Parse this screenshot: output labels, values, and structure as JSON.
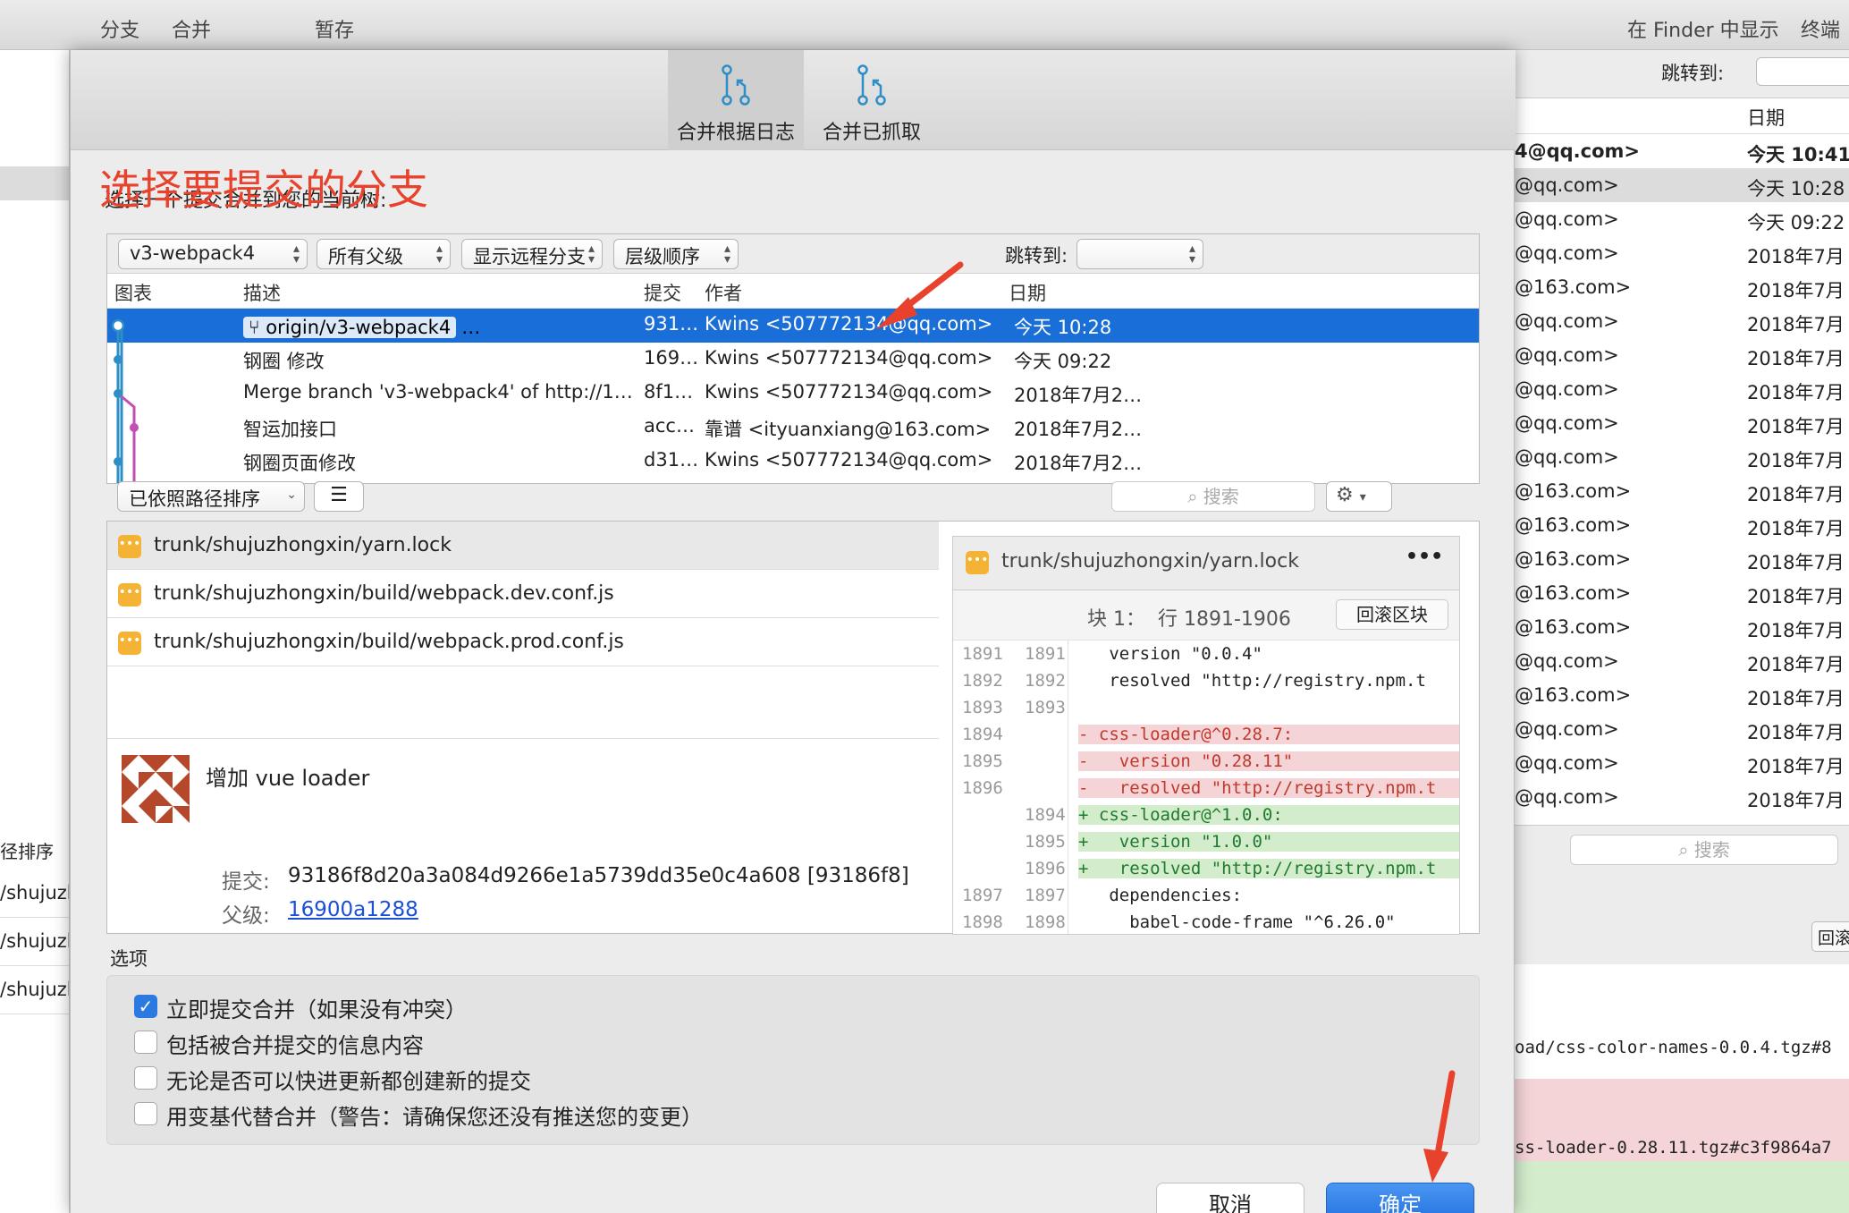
{
  "background": {
    "toolbar": {
      "items": [
        "分支",
        "合并",
        "暂存"
      ],
      "finder": "在 Finder 中显示",
      "terminal": "终端"
    },
    "jump_label": "跳转到:",
    "date_header": "日期",
    "left_items": [
      "径排序",
      "/shujuzh",
      "/shujuzh",
      "/shujuzh"
    ],
    "rows": [
      {
        "email": "4@qq.com>",
        "date": "今天 10:41"
      },
      {
        "email": "@qq.com>",
        "date": "今天 10:28"
      },
      {
        "email": "@qq.com>",
        "date": "今天 09:22"
      },
      {
        "email": "@qq.com>",
        "date": "2018年7月"
      },
      {
        "email": "@163.com>",
        "date": "2018年7月"
      },
      {
        "email": "@qq.com>",
        "date": "2018年7月"
      },
      {
        "email": "@qq.com>",
        "date": "2018年7月"
      },
      {
        "email": "@qq.com>",
        "date": "2018年7月"
      },
      {
        "email": "@qq.com>",
        "date": "2018年7月"
      },
      {
        "email": "@qq.com>",
        "date": "2018年7月"
      },
      {
        "email": "@163.com>",
        "date": "2018年7月"
      },
      {
        "email": "@163.com>",
        "date": "2018年7月"
      },
      {
        "email": "@163.com>",
        "date": "2018年7月"
      },
      {
        "email": "@163.com>",
        "date": "2018年7月"
      },
      {
        "email": "@163.com>",
        "date": "2018年7月"
      },
      {
        "email": "@qq.com>",
        "date": "2018年7月"
      },
      {
        "email": "@163.com>",
        "date": "2018年7月"
      },
      {
        "email": "@qq.com>",
        "date": "2018年7月"
      },
      {
        "email": "@qq.com>",
        "date": "2018年7月"
      },
      {
        "email": "@qq.com>",
        "date": "2018年7月"
      }
    ],
    "search_placeholder": "搜索",
    "revert_label": "回滚",
    "diff_lines": [
      "oad/css-color-names-0.0.4.tgz#8",
      "ss-loader-0.28.11.tgz#c3f9864a7"
    ]
  },
  "sheet": {
    "tabs": [
      {
        "label": "合并根据日志",
        "active": true
      },
      {
        "label": "合并已抓取",
        "active": false
      }
    ],
    "annotation": "选择要提交的分支",
    "instruction": "选择一个提交合并到您的当前树:",
    "filters": {
      "branch": "v3-webpack4",
      "parents": "所有父级",
      "remote": "显示远程分支",
      "order": "层级顺序",
      "jump_label": "跳转到:",
      "jump_value": ""
    },
    "columns": {
      "graph": "图表",
      "desc": "描述",
      "commit": "提交",
      "author": "作者",
      "date": "日期"
    },
    "commits": [
      {
        "tags": [
          "origin/v3-webpack4",
          "v3-webpack4"
        ],
        "desc": "增加 vue load...",
        "hash": "9318...",
        "author": "Kwins <507772134@qq.com>",
        "date": "今天 10:28",
        "selected": true
      },
      {
        "tags": [],
        "desc": "钢圈 修改",
        "hash": "1690...",
        "author": "Kwins <507772134@qq.com>",
        "date": "今天 09:22",
        "selected": false
      },
      {
        "tags": [],
        "desc": "Merge branch 'v3-webpack4' of http://1.193.162.246:...",
        "hash": "8f16...",
        "author": "Kwins <507772134@qq.com>",
        "date": "2018年7月21日 1...",
        "selected": false
      },
      {
        "tags": [],
        "desc": "智运加接口",
        "hash": "acca...",
        "author": "靠谱 <ityuanxiang@163.com>",
        "date": "2018年7月20日 2...",
        "selected": false
      },
      {
        "tags": [],
        "desc": "钢圈页面修改",
        "hash": "d315...",
        "author": "Kwins <507772134@qq.com>",
        "date": "2018年7月21日 1...",
        "selected": false
      }
    ],
    "sort_label": "已依照路径排序",
    "search_placeholder": "搜索",
    "files": [
      "trunk/shujuzhongxin/yarn.lock",
      "trunk/shujuzhongxin/build/webpack.dev.conf.js",
      "trunk/shujuzhongxin/build/webpack.prod.conf.js"
    ],
    "commit_detail": {
      "title": "增加 vue loader",
      "commit_label": "提交:",
      "commit_value": "93186f8d20a3a084d9266e1a5739dd35e0c4a608 [93186f8]",
      "parent_label": "父级:",
      "parent_value": "16900a1288"
    },
    "diff": {
      "file": "trunk/shujuzhongxin/yarn.lock",
      "more": "•••",
      "hunk": "块 1：  行 1891-1906",
      "revert": "回滚区块",
      "lines": [
        {
          "o": "1891",
          "n": "1891",
          "t": "   version \"0.0.4\"",
          "k": "ctx"
        },
        {
          "o": "1892",
          "n": "1892",
          "t": "   resolved \"http://registry.npm.t",
          "k": "ctx"
        },
        {
          "o": "1893",
          "n": "1893",
          "t": "",
          "k": "ctx"
        },
        {
          "o": "1894",
          "n": "",
          "t": "- css-loader@^0.28.7:",
          "k": "del"
        },
        {
          "o": "1895",
          "n": "",
          "t": "-   version \"0.28.11\"",
          "k": "del"
        },
        {
          "o": "1896",
          "n": "",
          "t": "-   resolved \"http://registry.npm.t",
          "k": "del"
        },
        {
          "o": "",
          "n": "1894",
          "t": "+ css-loader@^1.0.0:",
          "k": "add"
        },
        {
          "o": "",
          "n": "1895",
          "t": "+   version \"1.0.0\"",
          "k": "add"
        },
        {
          "o": "",
          "n": "1896",
          "t": "+   resolved \"http://registry.npm.t",
          "k": "add"
        },
        {
          "o": "1897",
          "n": "1897",
          "t": "   dependencies:",
          "k": "ctx"
        },
        {
          "o": "1898",
          "n": "1898",
          "t": "     babel-code-frame \"^6.26.0\"",
          "k": "ctx"
        }
      ]
    },
    "options_label": "选项",
    "options": [
      {
        "label": "立即提交合并（如果没有冲突）",
        "checked": true
      },
      {
        "label": "包括被合并提交的信息内容",
        "checked": false
      },
      {
        "label": "无论是否可以快进更新都创建新的提交",
        "checked": false
      },
      {
        "label": "用变基代替合并（警告：请确保您还没有推送您的变更）",
        "checked": false
      }
    ],
    "cancel": "取消",
    "ok": "确定"
  },
  "colors": {
    "accent": "#1a6ed8",
    "annotation": "#e8412c",
    "deleted": "#f4d4d6",
    "added": "#d3eccc",
    "graph": "#2e8fc6",
    "graph2": "#c44fb4"
  }
}
